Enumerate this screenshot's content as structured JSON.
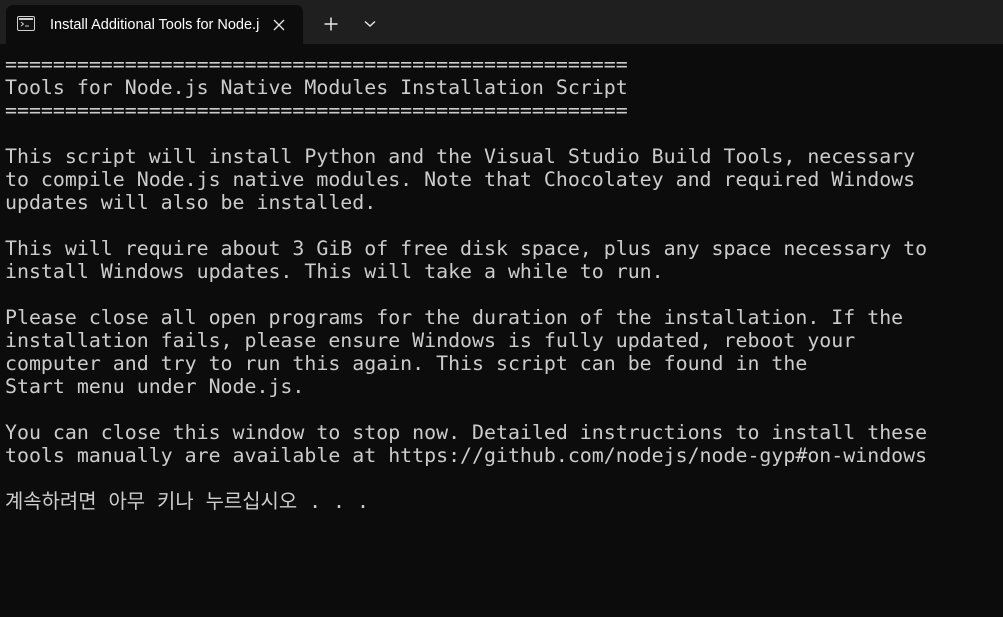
{
  "tab": {
    "title": "Install Additional Tools for Node.js",
    "icon": "terminal-icon",
    "close_icon": "close-icon"
  },
  "tabbar": {
    "new_tab_icon": "plus-icon",
    "dropdown_icon": "chevron-down-icon"
  },
  "terminal": {
    "lines": [
      "====================================================",
      "Tools for Node.js Native Modules Installation Script",
      "====================================================",
      "",
      "This script will install Python and the Visual Studio Build Tools, necessary",
      "to compile Node.js native modules. Note that Chocolatey and required Windows",
      "updates will also be installed.",
      "",
      "This will require about 3 GiB of free disk space, plus any space necessary to",
      "install Windows updates. This will take a while to run.",
      "",
      "Please close all open programs for the duration of the installation. If the",
      "installation fails, please ensure Windows is fully updated, reboot your",
      "computer and try to run this again. This script can be found in the",
      "Start menu under Node.js.",
      "",
      "You can close this window to stop now. Detailed instructions to install these",
      "tools manually are available at https://github.com/nodejs/node-gyp#on-windows",
      "",
      "계속하려면 아무 키나 누르십시오 . . ."
    ]
  },
  "colors": {
    "background": "#0c0c0c",
    "tabbar": "#1f1f1f",
    "text": "#cccccc",
    "tab_title": "#ffffff"
  }
}
